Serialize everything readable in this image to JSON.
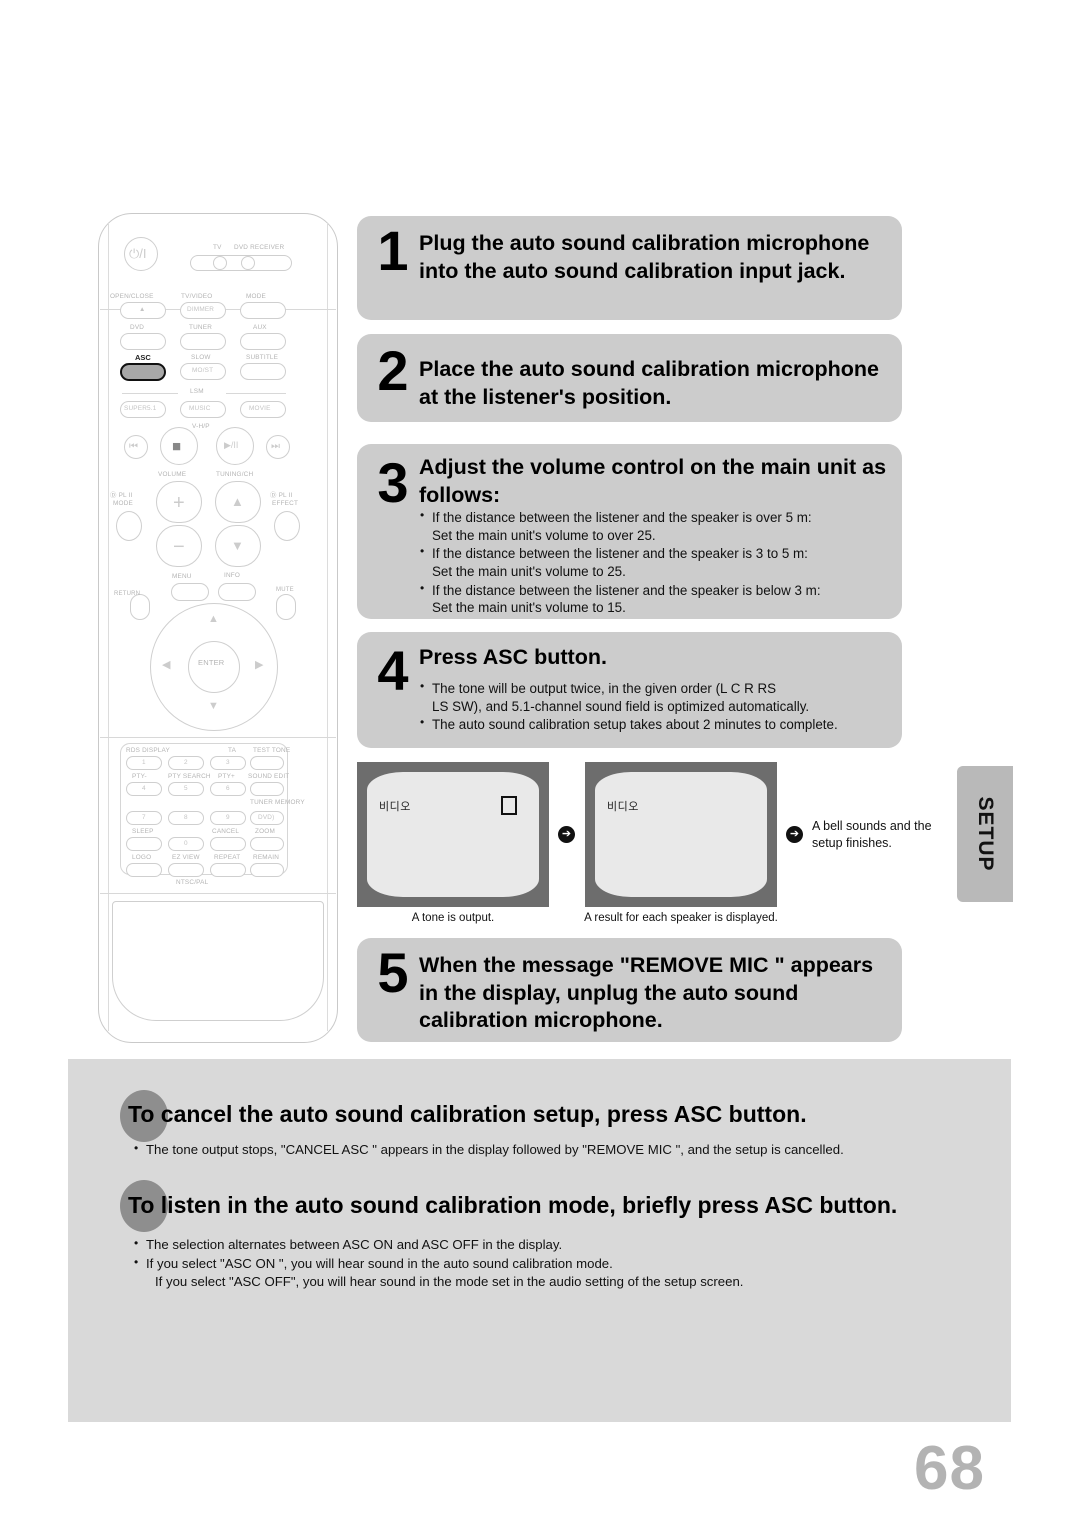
{
  "page": {
    "number": "68",
    "side_tab": "SETUP"
  },
  "remote": {
    "power_glyph": "⏻/I",
    "top_selector": {
      "tv": "TV",
      "dvd_receiver": "DVD RECEIVER"
    },
    "row1": [
      {
        "label": "OPEN/CLOSE",
        "inner": "▲"
      },
      {
        "label": "TV/VIDEO",
        "inner": "DIMMER"
      },
      {
        "label": "MODE",
        "inner": ""
      }
    ],
    "row2": [
      {
        "label": "DVD",
        "inner": ""
      },
      {
        "label": "TUNER",
        "inner": ""
      },
      {
        "label": "AUX",
        "inner": ""
      }
    ],
    "row3": [
      {
        "label": "ASC",
        "inner": "",
        "highlighted": true
      },
      {
        "label": "SLOW",
        "inner": "MO/ST"
      },
      {
        "label": "SUBTITLE",
        "inner": ""
      }
    ],
    "lsm_divider": "LSM",
    "row4": [
      {
        "inner": "SUPER5.1"
      },
      {
        "inner": "MUSIC"
      },
      {
        "inner": "MOVIE"
      }
    ],
    "vhp_label": "V-H/P",
    "transport": {
      "prev": "⏮",
      "stop": "■",
      "play_pause": "▶/II",
      "next": "⏭"
    },
    "volume_label": "VOLUME",
    "tuning_label": "TUNING/CH",
    "plii_mode": {
      "badge": "Ⓓ PL II",
      "label": "MODE"
    },
    "plii_effect": {
      "badge": "Ⓓ PL II",
      "label": "EFFECT"
    },
    "vol_plus": "+",
    "vol_minus": "−",
    "tune_up": "∧",
    "tune_down": "∨",
    "menu_label": "MENU",
    "info_label": "INFO",
    "return_label": "RETURN",
    "mute_label": "MUTE",
    "enter_label": "ENTER",
    "nav": {
      "up": "▲",
      "down": "▼",
      "left": "◀",
      "right": "▶"
    },
    "keypad": [
      {
        "top": "RDS DISPLAY",
        "key": "1"
      },
      {
        "top": "",
        "key": "2"
      },
      {
        "top": "TA",
        "key": "3"
      },
      {
        "top": "TEST TONE",
        "key": ""
      },
      {
        "top": "PTY-",
        "key": "4"
      },
      {
        "top": "PTY SEARCH",
        "key": "5"
      },
      {
        "top": "PTY+",
        "key": "6"
      },
      {
        "top": "SOUND EDIT",
        "key": ""
      },
      {
        "top": "",
        "key": "7"
      },
      {
        "top": "",
        "key": "8"
      },
      {
        "top": "",
        "key": "9"
      },
      {
        "top": "TUNER MEMORY",
        "key": "DVD)"
      },
      {
        "top": "SLEEP",
        "key": ""
      },
      {
        "top": "",
        "key": "0"
      },
      {
        "top": "CANCEL",
        "key": ""
      },
      {
        "top": "ZOOM",
        "key": ""
      },
      {
        "top": "LOGO",
        "key": ""
      },
      {
        "top": "EZ VIEW",
        "key": ""
      },
      {
        "top": "REPEAT",
        "key": ""
      },
      {
        "top": "REMAIN",
        "key": ""
      }
    ],
    "keypad_bottom_label": "NTSC/PAL"
  },
  "steps": [
    {
      "number": "1",
      "title": "Plug the auto sound calibration microphone into the auto sound calibration input jack.",
      "bullets": []
    },
    {
      "number": "2",
      "title": "Place the auto sound calibration microphone at the listener's position.",
      "bullets": []
    },
    {
      "number": "3",
      "title": "Adjust the volume control on the main unit as follows:",
      "bullets": [
        {
          "main": "If the distance between the listener and the speaker is over 5 m:",
          "sub": "Set the main unit's volume to over 25."
        },
        {
          "main": "If the distance between the listener and the speaker is 3 to 5 m:",
          "sub": "Set the main unit's volume to 25."
        },
        {
          "main": "If the distance between the listener and the speaker is below 3 m:",
          "sub": "Set the main unit's volume to 15."
        }
      ]
    },
    {
      "number": "4",
      "title": "Press ASC button.",
      "bullets": [
        {
          "main": "The tone will be output twice, in the given order (L    C    R    RS",
          "sub": "LS    SW), and 5.1-channel sound field is optimized automatically."
        },
        {
          "main": "The auto sound calibration setup takes about 2 minutes to complete.",
          "sub": ""
        }
      ]
    },
    {
      "number": "5",
      "title": "When the message \"REMOVE MIC  \" appears in the display, unplug the auto sound calibration microphone.",
      "bullets": []
    }
  ],
  "tv_sequence": {
    "screen1": {
      "korean_text": "비디오",
      "caption": "A tone is output."
    },
    "screen2": {
      "korean_text": "비디오",
      "caption": "A result for each speaker is displayed."
    },
    "arrow": "➔",
    "final_note": "A bell sounds and the setup finishes."
  },
  "bottom_panel": {
    "section1": {
      "lead": "To",
      "heading": "cancel the auto sound calibration setup, press ASC button.",
      "bullets": [
        {
          "main": "The tone output stops, \"CANCEL ASC \" appears in the display followed by \"REMOVE MIC  \", and the setup is cancelled.",
          "sub": ""
        }
      ]
    },
    "section2": {
      "lead": "To",
      "heading": "listen in the auto sound calibration mode, briefly press ASC button.",
      "bullets": [
        {
          "main": "The selection alternates between ASC ON  and ASC OFF in the display.",
          "sub": ""
        },
        {
          "main": "If you select \"ASC ON \", you will hear sound in the auto sound calibration mode.",
          "sub": "If you select \"ASC OFF\", you will hear sound  in the mode set in the audio setting of the setup screen."
        }
      ]
    }
  },
  "colors": {
    "step_box": "#cccccc",
    "panel_bg": "#d9d9d9",
    "tab_bg": "#b9b9b9",
    "tv_frame": "#6d6d6d",
    "tv_screen": "#e9e9e9",
    "circle_bullet": "#8e8e8e",
    "page_number": "#b3b3b3"
  }
}
